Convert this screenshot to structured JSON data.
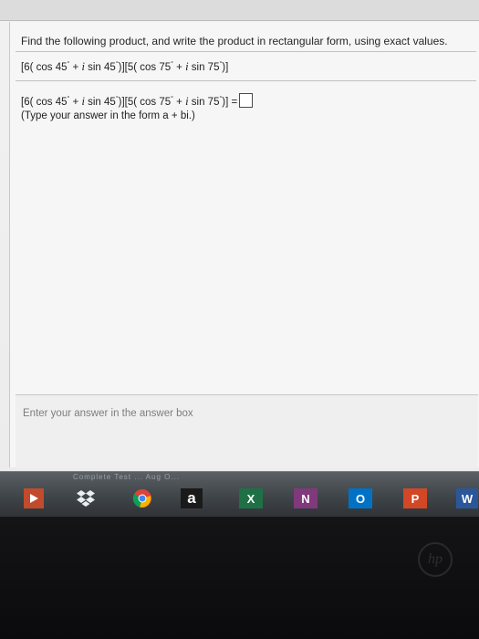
{
  "question": {
    "prompt": "Find the following product, and write the product in rectangular form, using exact values."
  },
  "expression": {
    "open1": "[6( cos 45",
    "plus1": "+",
    "i1": "i",
    "sin1": "sin 45",
    "mid": ")][5( cos 75",
    "plus2": "+",
    "i2": "i",
    "sin2": "sin 75",
    "close": ")]",
    "degree": "°"
  },
  "answer": {
    "equals": "=",
    "hint": "(Type your answer in the form a + bi.)"
  },
  "status": {
    "text": "Enter your answer in the answer box"
  },
  "taskbar": {
    "faded_text": "Complete Test ... Aug O...",
    "apps": [
      {
        "name": "media-icon",
        "label": ""
      },
      {
        "name": "dropbox-icon",
        "label": ""
      },
      {
        "name": "chrome-icon",
        "label": ""
      },
      {
        "name": "amazon-icon",
        "label": "a"
      },
      {
        "name": "excel-icon",
        "label": "X"
      },
      {
        "name": "onenote-icon",
        "label": "N"
      },
      {
        "name": "outlook-icon",
        "label": "O"
      },
      {
        "name": "powerpoint-icon",
        "label": "P"
      },
      {
        "name": "word-icon",
        "label": "W"
      }
    ]
  },
  "colors": {
    "excel": "#1e7145",
    "onenote": "#80397b",
    "outlook": "#0072c6",
    "powerpoint": "#d24726",
    "word": "#2b579a",
    "dropbox": "#3d9ae8"
  }
}
